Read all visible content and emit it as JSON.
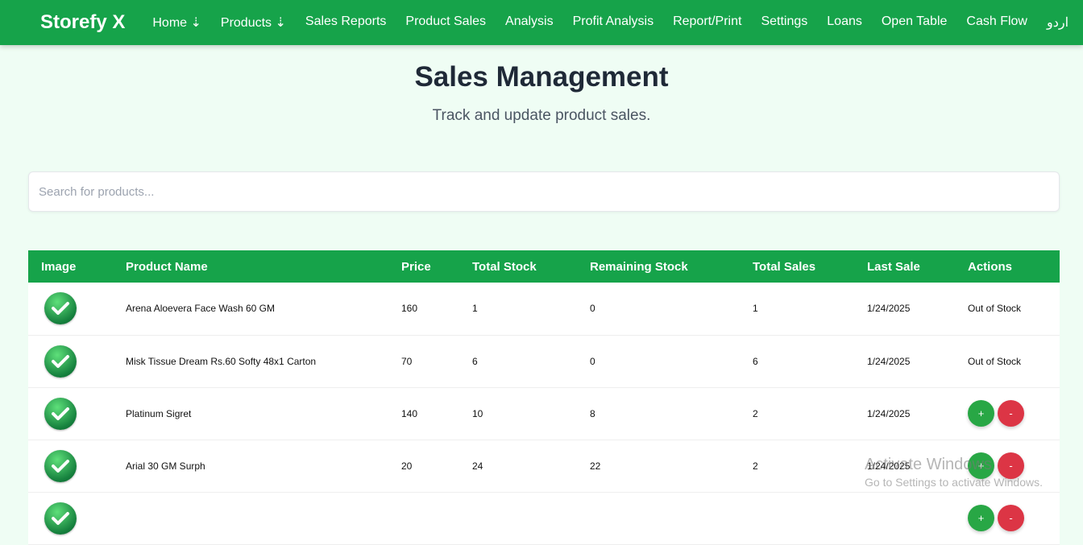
{
  "nav": {
    "brand": "Storefy X",
    "items": [
      "Home ⇣",
      "Products ⇣",
      "Sales Reports",
      "Product Sales",
      "Analysis",
      "Profit Analysis",
      "Report/Print",
      "Settings",
      "Loans",
      "Open Table",
      "Cash Flow",
      "اردو"
    ]
  },
  "page": {
    "title": "Sales Management",
    "subtitle": "Track and update product sales."
  },
  "search": {
    "placeholder": "Search for products...",
    "value": ""
  },
  "table": {
    "headers": [
      "Image",
      "Product Name",
      "Price",
      "Total Stock",
      "Remaining Stock",
      "Total Sales",
      "Last Sale",
      "Actions"
    ],
    "rows": [
      {
        "name": "Arena Aloevera Face Wash 60 GM",
        "price": "160",
        "total": "1",
        "remaining": "0",
        "sales": "1",
        "last": "1/24/2025",
        "action": "Out of Stock"
      },
      {
        "name": "Misk Tissue Dream Rs.60 Softy 48x1 Carton",
        "price": "70",
        "total": "6",
        "remaining": "0",
        "sales": "6",
        "last": "1/24/2025",
        "action": "Out of Stock"
      },
      {
        "name": "Platinum Sigret",
        "price": "140",
        "total": "10",
        "remaining": "8",
        "sales": "2",
        "last": "1/24/2025",
        "action": "buttons"
      },
      {
        "name": "Arial 30 GM Surph",
        "price": "20",
        "total": "24",
        "remaining": "22",
        "sales": "2",
        "last": "1/24/2025",
        "action": "buttons"
      },
      {
        "name": "",
        "price": "",
        "total": "",
        "remaining": "",
        "sales": "",
        "last": "",
        "action": "buttons"
      }
    ],
    "plus_label": "+",
    "minus_label": "-"
  },
  "watermark": {
    "line1": "Activate Windows",
    "line2": "Go to Settings to activate Windows."
  },
  "colors": {
    "primary": "#16a34a",
    "plus": "#28a745",
    "minus": "#dc3545",
    "background": "#effdf4"
  }
}
